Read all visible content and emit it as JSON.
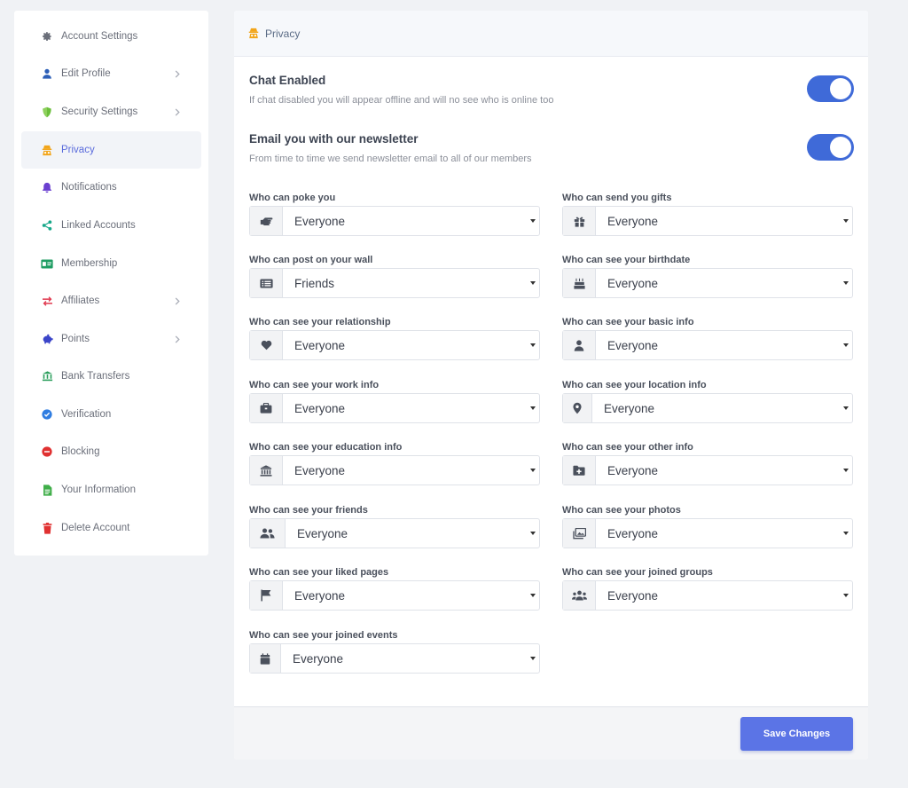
{
  "sidebar": {
    "items": [
      {
        "label": "Account Settings",
        "icon": "gear-icon",
        "color": "#6b6f7a",
        "chevron": false
      },
      {
        "label": "Edit Profile",
        "icon": "user-icon",
        "color": "#2d5fb8",
        "chevron": true
      },
      {
        "label": "Security Settings",
        "icon": "shield-icon",
        "color": "#6bbf3b",
        "chevron": true
      },
      {
        "label": "Privacy",
        "icon": "incognito-icon",
        "color": "#f2a51a",
        "chevron": false,
        "active": true
      },
      {
        "label": "Notifications",
        "icon": "bell-icon",
        "color": "#6a3fd0",
        "chevron": false
      },
      {
        "label": "Linked Accounts",
        "icon": "share-icon",
        "color": "#18a88a",
        "chevron": false
      },
      {
        "label": "Membership",
        "icon": "id-card-icon",
        "color": "#1f9d63",
        "chevron": false
      },
      {
        "label": "Affiliates",
        "icon": "exchange-icon",
        "color": "#e0394f",
        "chevron": true
      },
      {
        "label": "Points",
        "icon": "piggy-bank-icon",
        "color": "#3b45c9",
        "chevron": true
      },
      {
        "label": "Bank Transfers",
        "icon": "bank-icon",
        "color": "#2a9d5b",
        "chevron": false
      },
      {
        "label": "Verification",
        "icon": "check-badge-icon",
        "color": "#2f7de1",
        "chevron": false
      },
      {
        "label": "Blocking",
        "icon": "minus-circle-icon",
        "color": "#e03131",
        "chevron": false
      },
      {
        "label": "Your Information",
        "icon": "document-icon",
        "color": "#3fae49",
        "chevron": false
      },
      {
        "label": "Delete Account",
        "icon": "trash-icon",
        "color": "#e03131",
        "chevron": false
      }
    ]
  },
  "panel": {
    "title": "Privacy",
    "title_icon": "incognito-icon",
    "toggles": [
      {
        "title": "Chat Enabled",
        "description": "If chat disabled you will appear offline and will no see who is online too",
        "on": true
      },
      {
        "title": "Email you with our newsletter",
        "description": "From time to time we send newsletter email to all of our members",
        "on": true
      }
    ],
    "fields": [
      {
        "label": "Who can poke you",
        "value": "Everyone",
        "icon": "hand-point-icon"
      },
      {
        "label": "Who can send you gifts",
        "value": "Everyone",
        "icon": "gift-icon"
      },
      {
        "label": "Who can post on your wall",
        "value": "Friends",
        "icon": "list-icon"
      },
      {
        "label": "Who can see your birthdate",
        "value": "Everyone",
        "icon": "cake-icon"
      },
      {
        "label": "Who can see your relationship",
        "value": "Everyone",
        "icon": "heart-icon"
      },
      {
        "label": "Who can see your basic info",
        "value": "Everyone",
        "icon": "person-icon"
      },
      {
        "label": "Who can see your work info",
        "value": "Everyone",
        "icon": "briefcase-icon"
      },
      {
        "label": "Who can see your location info",
        "value": "Everyone",
        "icon": "map-pin-icon"
      },
      {
        "label": "Who can see your education info",
        "value": "Everyone",
        "icon": "university-icon"
      },
      {
        "label": "Who can see your other info",
        "value": "Everyone",
        "icon": "folder-plus-icon"
      },
      {
        "label": "Who can see your friends",
        "value": "Everyone",
        "icon": "users-icon"
      },
      {
        "label": "Who can see your photos",
        "value": "Everyone",
        "icon": "images-icon"
      },
      {
        "label": "Who can see your liked pages",
        "value": "Everyone",
        "icon": "flag-icon"
      },
      {
        "label": "Who can see your joined groups",
        "value": "Everyone",
        "icon": "group-icon"
      },
      {
        "label": "Who can see your joined events",
        "value": "Everyone",
        "icon": "calendar-icon"
      }
    ],
    "save_label": "Save Changes"
  },
  "colors": {
    "accent": "#3f6ad8",
    "button": "#5b74e6",
    "active_text": "#5a6bdc"
  }
}
